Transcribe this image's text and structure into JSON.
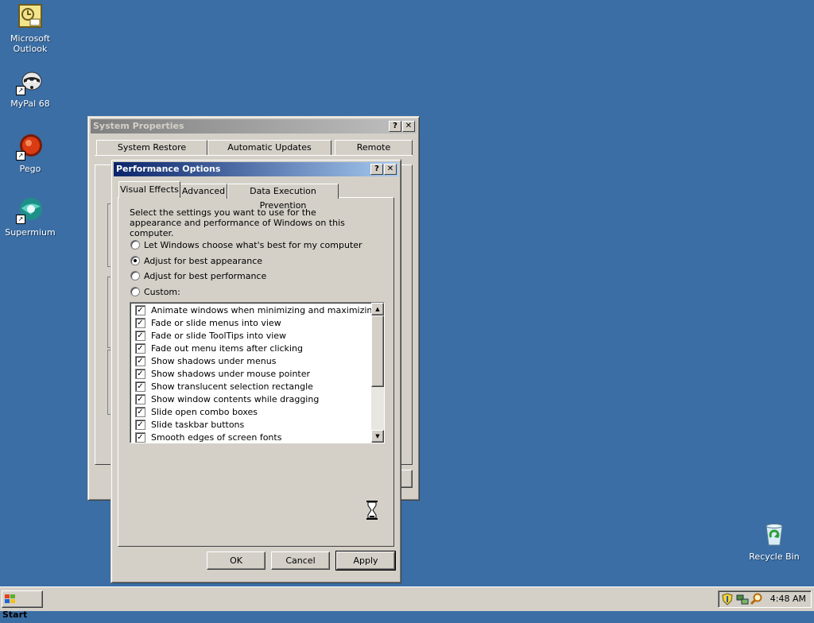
{
  "desktop": {
    "icons": [
      {
        "label": "Microsoft\nOutlook",
        "icon": "outlook-icon"
      },
      {
        "label": "MyPal 68",
        "icon": "raccoon-icon"
      },
      {
        "label": "Pego",
        "icon": "pego-icon"
      },
      {
        "label": "Supermium",
        "icon": "supermium-icon"
      },
      {
        "label": "Recycle Bin",
        "icon": "recycle-bin-icon"
      }
    ]
  },
  "system_properties": {
    "title": "System Properties",
    "help": "?",
    "close": "✕",
    "tabs": [
      "System Restore",
      "Automatic Updates",
      "Remote"
    ]
  },
  "performance_options": {
    "title": "Performance Options",
    "help": "?",
    "close": "✕",
    "tabs": [
      "Visual Effects",
      "Advanced",
      "Data Execution Prevention"
    ],
    "description": "Select the settings you want to use for the appearance and performance of Windows on this computer.",
    "radios": [
      {
        "label": "Let Windows choose what's best for my computer",
        "selected": false
      },
      {
        "label": "Adjust for best appearance",
        "selected": true
      },
      {
        "label": "Adjust for best performance",
        "selected": false
      },
      {
        "label": "Custom:",
        "selected": false
      }
    ],
    "effects": [
      "Animate windows when minimizing and maximizing",
      "Fade or slide menus into view",
      "Fade or slide ToolTips into view",
      "Fade out menu items after clicking",
      "Show shadows under menus",
      "Show shadows under mouse pointer",
      "Show translucent selection rectangle",
      "Show window contents while dragging",
      "Slide open combo boxes",
      "Slide taskbar buttons",
      "Smooth edges of screen fonts"
    ],
    "buttons": {
      "ok": "OK",
      "cancel": "Cancel",
      "apply": "Apply"
    }
  },
  "taskbar": {
    "start": "Start",
    "clock": "4:48 AM"
  },
  "colors": {
    "desktop": "#3a6ea5",
    "title_active": "#0a246a",
    "title_inactive": "#808080",
    "face": "#d4d0c8"
  }
}
